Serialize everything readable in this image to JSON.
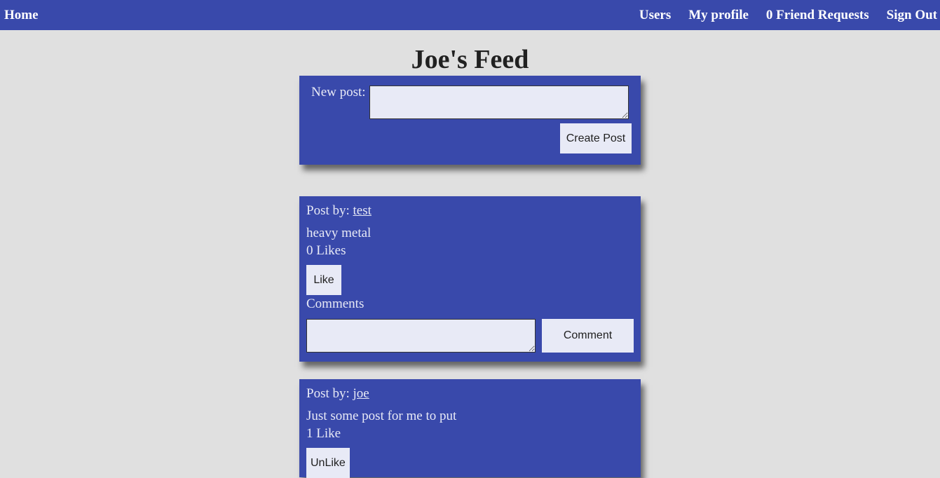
{
  "nav": {
    "home": "Home",
    "links": [
      "Users",
      "My profile",
      "0 Friend Requests",
      "Sign Out"
    ]
  },
  "page": {
    "title": "Joe's Feed"
  },
  "new_post": {
    "label": "New post:",
    "value": "",
    "button": "Create Post"
  },
  "posts": [
    {
      "by_label": "Post by:",
      "author": "test",
      "content": "heavy metal",
      "likes": "0 Likes",
      "like_button": "Like",
      "comments_label": "Comments",
      "comment_value": "",
      "comment_button": "Comment"
    },
    {
      "by_label": "Post by:",
      "author": "joe",
      "content": "Just some post for me to put",
      "likes": "1 Like",
      "like_button": "UnLike"
    }
  ],
  "colors": {
    "primary": "#3949ab",
    "background": "#e0e0e0",
    "light": "#e8eaf6"
  }
}
